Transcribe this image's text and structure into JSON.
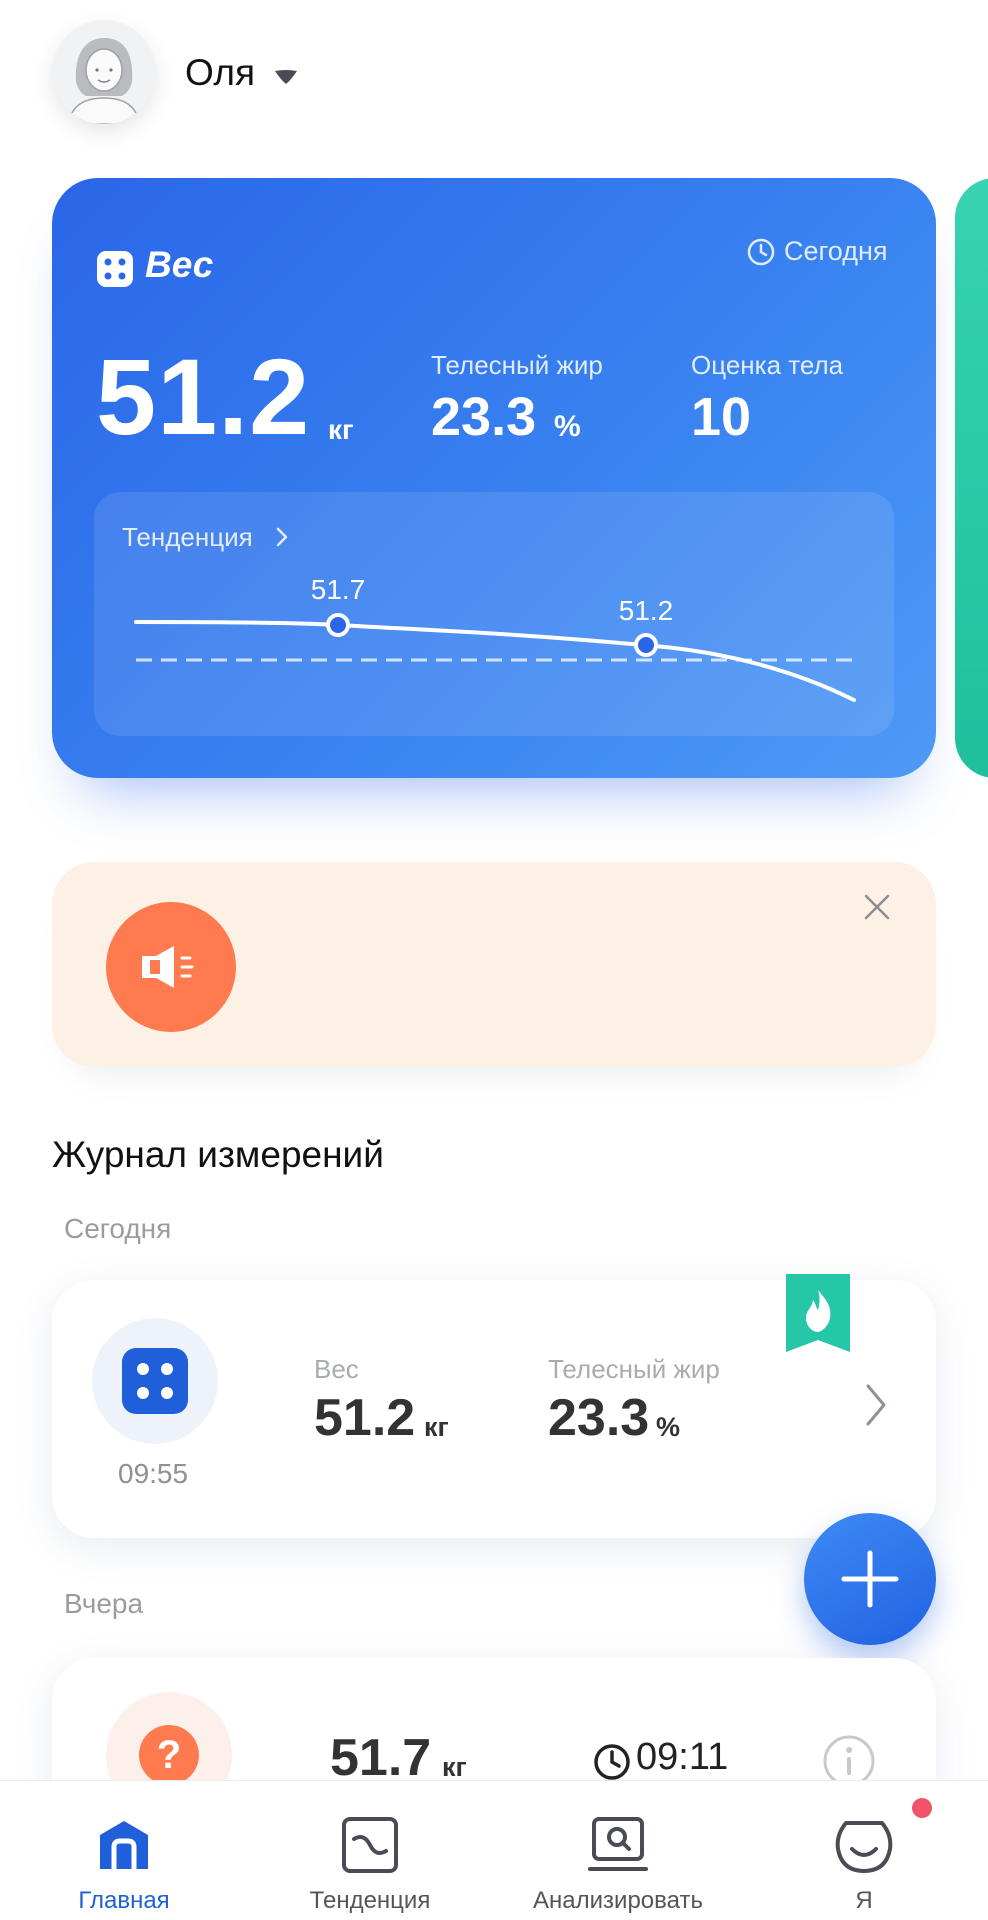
{
  "header": {
    "user_name": "Оля"
  },
  "weight_card": {
    "title": "Вес",
    "date_label": "Сегодня",
    "weight_value": "51.2",
    "weight_unit": "кг",
    "body_fat_label": "Телесный жир",
    "body_fat_value": "23.3",
    "body_fat_unit": "%",
    "body_score_label": "Оценка тела",
    "body_score_value": "10",
    "trend": {
      "label": "Тенденция",
      "points": [
        {
          "label": "51.7",
          "value": 51.7
        },
        {
          "label": "51.2",
          "value": 51.2
        }
      ]
    }
  },
  "log": {
    "title": "Журнал измерений",
    "today_label": "Сегодня",
    "today_entry": {
      "time": "09:55",
      "weight_label": "Вес",
      "weight_value": "51.2",
      "weight_unit": "кг",
      "fat_label": "Телесный жир",
      "fat_value": "23.3",
      "fat_unit": "%"
    },
    "yesterday_label": "Вчера",
    "yesterday_entry": {
      "weight_value": "51.7",
      "weight_unit": "кг",
      "time": "09:11"
    }
  },
  "nav": {
    "items": [
      {
        "label": "Главная",
        "icon": "home-icon",
        "active": true
      },
      {
        "label": "Тенденция",
        "icon": "trend-icon",
        "active": false
      },
      {
        "label": "Анализировать",
        "icon": "analyze-icon",
        "active": false
      },
      {
        "label": "Я",
        "icon": "profile-icon",
        "active": false
      }
    ]
  },
  "colors": {
    "accent": "#2a66e8",
    "notice_bg": "#fdf1e5",
    "notice_icon": "#ff7a4e",
    "badge": "#26c6a8",
    "notify_dot": "#f0566a"
  }
}
